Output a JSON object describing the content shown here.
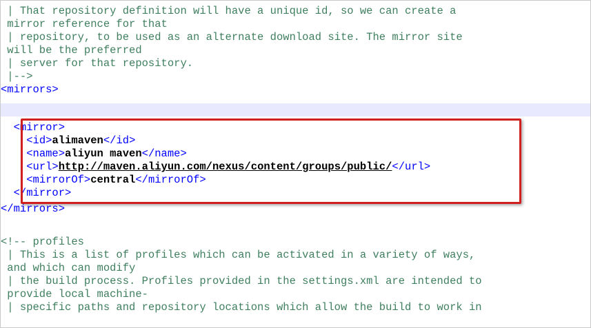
{
  "colors": {
    "comment": "#3f7f5f",
    "tag": "#0000ff",
    "value": "#000000",
    "current_line": "#e8e8ff",
    "highlight_box": "#d11f1f"
  },
  "lines": {
    "l1": " | That repository definition will have a unique id, so we can create a",
    "l2": " mirror reference for that",
    "l3": " | repository, to be used as an alternate download site. The mirror site",
    "l4": " will be the preferred",
    "l5": " | server for that repository.",
    "l6": " |-->",
    "l7": "<mirrors>",
    "l9": {
      "indent": "  ",
      "tag": "<mirror>"
    },
    "l10": {
      "indent": "    ",
      "open": "<id>",
      "value": "alimaven",
      "close": "</id>"
    },
    "l11": {
      "indent": "    ",
      "open": "<name>",
      "value": "aliyun maven",
      "close": "</name>"
    },
    "l12": {
      "indent": "    ",
      "open": "<url>",
      "value": "http://maven.aliyun.com/nexus/content/groups/public/",
      "close": "</url>"
    },
    "l13": {
      "indent": "    ",
      "open": "<mirrorOf>",
      "value": "central",
      "close": "</mirrorOf>"
    },
    "l14": {
      "indent": "  ",
      "tag": "</mirror>"
    },
    "l15": "</mirrors>",
    "l17": "<!-- profiles",
    "l18": " | This is a list of profiles which can be activated in a variety of ways,",
    "l19": " and which can modify",
    "l20": " | the build process. Profiles provided in the settings.xml are intended to",
    "l21": " provide local machine-",
    "l22": " | specific paths and repository locations which allow the build to work in"
  }
}
